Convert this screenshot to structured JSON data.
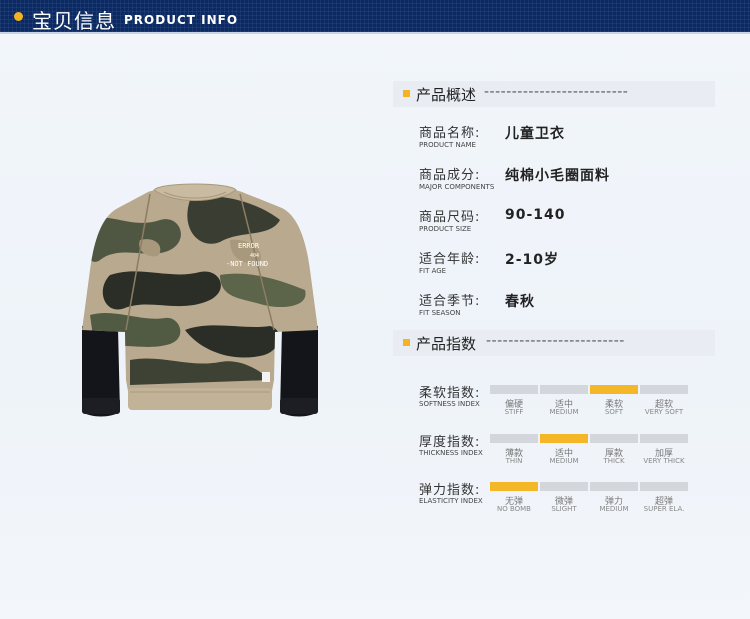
{
  "header": {
    "title_cn": "宝贝信息",
    "title_en": "PRODUCT INFO"
  },
  "product_image": {
    "print_line1": "ERROR",
    "print_line2": "404",
    "print_line3": "-NOT FOUND"
  },
  "overview": {
    "title": "产品概述",
    "dashes": "--------------------------",
    "rows": [
      {
        "label": "商品名称:",
        "label_en": "PRODUCT NAME",
        "value": "儿童卫衣"
      },
      {
        "label": "商品成分:",
        "label_en": "MAJOR COMPONENTS",
        "value": "纯棉小毛圈面料"
      },
      {
        "label": "商品尺码:",
        "label_en": "PRODUCT SIZE",
        "value": "90-140"
      },
      {
        "label": "适合年龄:",
        "label_en": "FIT AGE",
        "value": "2-10岁"
      },
      {
        "label": "适合季节:",
        "label_en": "FIT SEASON",
        "value": "春秋"
      }
    ]
  },
  "indices": {
    "title": "产品指数",
    "dashes": "-------------------------",
    "highlight_color": "#f4b728",
    "rows": [
      {
        "label": "柔软指数:",
        "label_en": "SOFTNESS INDEX",
        "selected": 2,
        "options": [
          {
            "cn": "偏硬",
            "en": "STIFF"
          },
          {
            "cn": "适中",
            "en": "MEDIUM"
          },
          {
            "cn": "柔软",
            "en": "SOFT"
          },
          {
            "cn": "超软",
            "en": "VERY SOFT"
          }
        ]
      },
      {
        "label": "厚度指数:",
        "label_en": "THICKNESS INDEX",
        "selected": 1,
        "options": [
          {
            "cn": "薄款",
            "en": "THIN"
          },
          {
            "cn": "适中",
            "en": "MEDIUM"
          },
          {
            "cn": "厚款",
            "en": "THICK"
          },
          {
            "cn": "加厚",
            "en": "VERY THICK"
          }
        ]
      },
      {
        "label": "弹力指数:",
        "label_en": "ELASTICITY INDEX",
        "selected": 0,
        "options": [
          {
            "cn": "无弹",
            "en": "NO BOMB"
          },
          {
            "cn": "微弹",
            "en": "SLIGHT"
          },
          {
            "cn": "弹力",
            "en": "MEDIUM"
          },
          {
            "cn": "超弹",
            "en": "SUPER ELA."
          }
        ]
      }
    ]
  }
}
